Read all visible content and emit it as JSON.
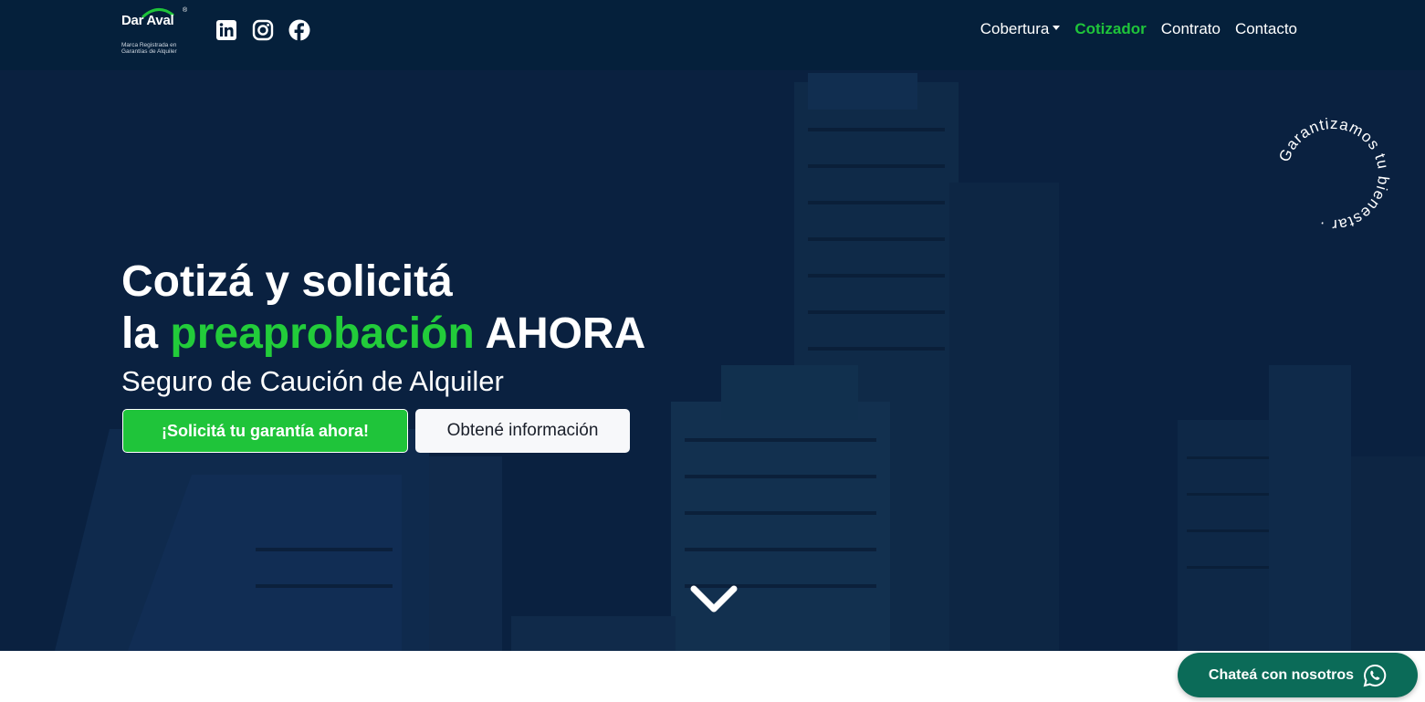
{
  "brand": {
    "name": "Dar Aval",
    "registered_mark": "®",
    "tagline": "Marca Registrada en Garantías de Alquiler"
  },
  "social": [
    {
      "icon": "linkedin-icon"
    },
    {
      "icon": "instagram-icon"
    },
    {
      "icon": "facebook-icon"
    }
  ],
  "nav": {
    "items": [
      {
        "label": "Cobertura",
        "dropdown": true
      },
      {
        "label": "Cotizador",
        "active": true
      },
      {
        "label": "Contrato"
      },
      {
        "label": "Contacto"
      }
    ]
  },
  "hero": {
    "line1": "Cotizá y solicitá",
    "line2_prefix": "la ",
    "line2_highlight": "preaprobación",
    "line2_suffix": " AHORA",
    "subtitle": "Seguro de Caución de Alquiler",
    "primary_button": "¡Solicitá tu garantía ahora!",
    "secondary_button": "Obtené información",
    "badge_text": "Garantizamos tu bienestar ·"
  },
  "chat": {
    "label": "Chateá con nosotros",
    "icon": "whatsapp-icon"
  },
  "colors": {
    "accent_green": "#1fc43a",
    "navbar_bg": "#05203b",
    "hero_overlay": "#0a2140",
    "chat_bg": "#0b6b58"
  }
}
